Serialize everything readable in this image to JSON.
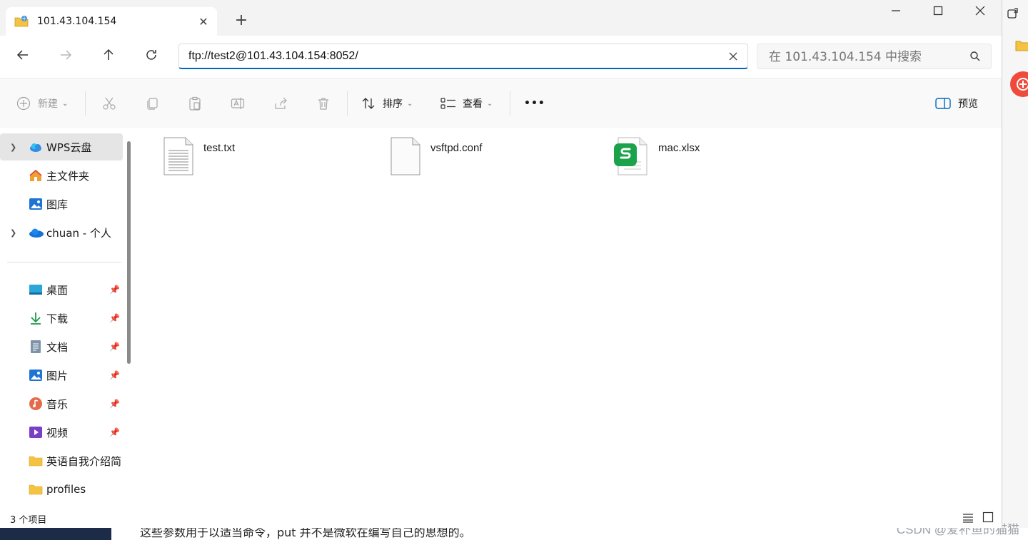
{
  "window": {
    "tab_title": "101.43.104.154",
    "new_tab": "+",
    "minimize": "—",
    "maximize": "☐",
    "close": "✕"
  },
  "address_bar": {
    "path": "ftp://test2@101.43.104.154:8052/",
    "search_placeholder": "在 101.43.104.154 中搜索"
  },
  "toolbar": {
    "new_label": "新建",
    "sort_label": "排序",
    "view_label": "查看",
    "more_label": "•••",
    "preview_label": "预览"
  },
  "sidebar": {
    "items": [
      {
        "label": "WPS云盘",
        "icon": "cloud-icon"
      },
      {
        "label": "主文件夹",
        "icon": "home-icon"
      },
      {
        "label": "图库",
        "icon": "gallery-icon"
      },
      {
        "label": "chuan - 个人",
        "icon": "onedrive-icon"
      },
      {
        "label": "桌面",
        "icon": "desktop-icon"
      },
      {
        "label": "下载",
        "icon": "download-icon"
      },
      {
        "label": "文档",
        "icon": "document-icon"
      },
      {
        "label": "图片",
        "icon": "pictures-icon"
      },
      {
        "label": "音乐",
        "icon": "music-icon"
      },
      {
        "label": "视频",
        "icon": "video-icon"
      },
      {
        "label": "英语自我介绍简",
        "icon": "folder-icon"
      },
      {
        "label": "profiles",
        "icon": "folder-icon"
      }
    ]
  },
  "files": [
    {
      "name": "test.txt",
      "icon": "text-file-icon"
    },
    {
      "name": "vsftpd.conf",
      "icon": "blank-file-icon"
    },
    {
      "name": "mac.xlsx",
      "icon": "wps-sheet-icon"
    }
  ],
  "status": {
    "count": "3 个项目"
  },
  "background": {
    "text": "这些参数用于以适当命令，put 并不是微软在编写自己的思想的。",
    "watermark": "CSDN @爱补鱼的猫猫"
  },
  "colors": {
    "accent": "#0067c0",
    "wps_green": "#1aa34a"
  }
}
